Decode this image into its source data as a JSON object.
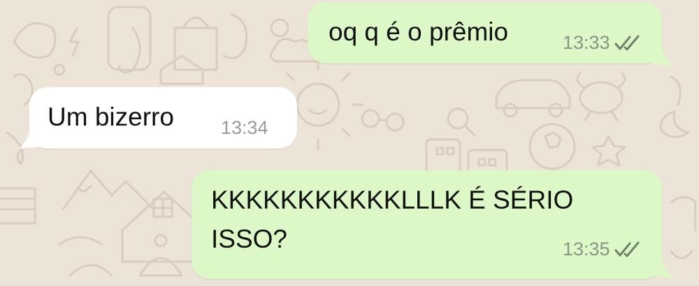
{
  "chat": {
    "messages": [
      {
        "direction": "outgoing",
        "lines": [
          "oq q é o prêmio"
        ],
        "time": "13:33",
        "status": "read-double-check-icon"
      },
      {
        "direction": "incoming",
        "lines": [
          "Um bizerro"
        ],
        "time": "13:34"
      },
      {
        "direction": "outgoing",
        "lines": [
          "KKKKKKKKKKKLLLK É SÉRIO",
          "ISSO?"
        ],
        "time": "13:35",
        "status": "read-double-check-icon"
      }
    ]
  },
  "colors": {
    "wallpaper": "#ede4d8",
    "outgoing_bubble": "#dcf8c6",
    "incoming_bubble": "#ffffff",
    "timestamp": "#8a9588",
    "read_ticks": "#6f7f6c"
  }
}
